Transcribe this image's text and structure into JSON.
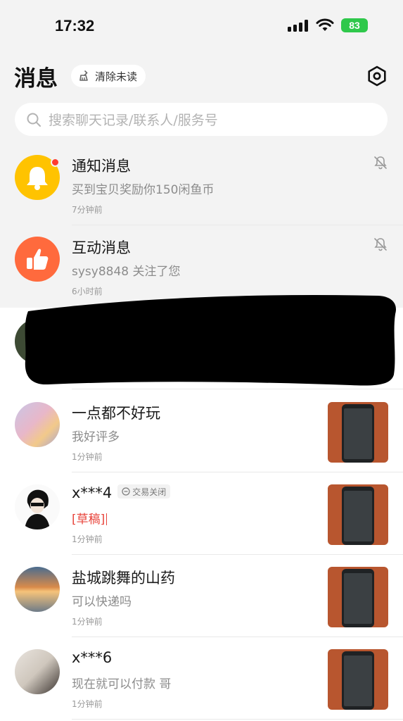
{
  "status_bar": {
    "time": "17:32",
    "battery": "83"
  },
  "header": {
    "title": "消息",
    "clear_unread": "清除未读"
  },
  "search": {
    "placeholder": "搜索聊天记录/联系人/服务号"
  },
  "system_items": [
    {
      "name": "通知消息",
      "preview": "买到宝贝奖励你150闲鱼币",
      "time": "7分钟前",
      "icon": "bell-icon",
      "color": "#ffc300",
      "has_unread_dot": true
    },
    {
      "name": "互动消息",
      "preview": "sysy8848 关注了您",
      "time": "6小时前",
      "icon": "thumbs-up-icon",
      "color": "#ff6a3d"
    }
  ],
  "conversations": [
    {
      "name": "一点都不好玩",
      "preview": "我好评多",
      "time": "1分钟前"
    },
    {
      "name": "x***4",
      "tag": "交易关闭",
      "draft_label": "[草稿]",
      "preview": "",
      "time": "1分钟前"
    },
    {
      "name": "盐城跳舞的山药",
      "preview": "可以快递吗",
      "time": "1分钟前"
    },
    {
      "name": "x***6",
      "preview": "现在就可以付款 哥",
      "time": "1分钟前"
    }
  ]
}
